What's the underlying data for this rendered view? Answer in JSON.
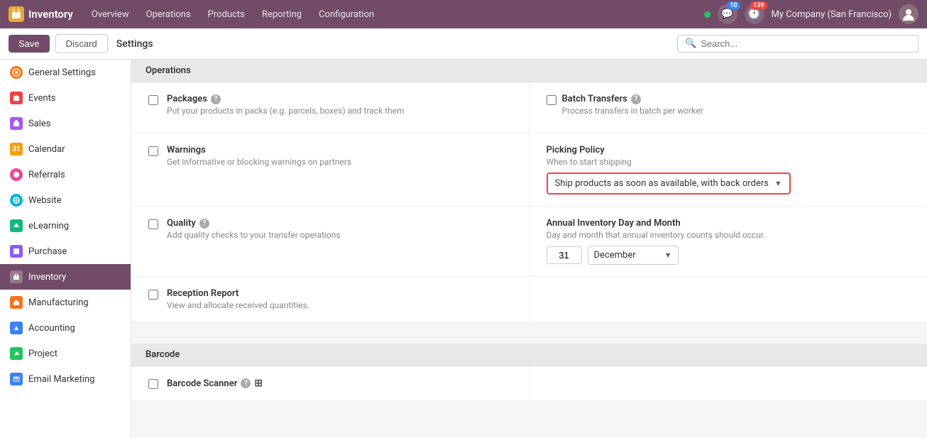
{
  "topnav": {
    "brand": "Inventory",
    "brand_icon": "📦",
    "nav_items": [
      "Overview",
      "Operations",
      "Products",
      "Reporting",
      "Configuration"
    ],
    "notifications": [
      {
        "count": "10",
        "type": "message",
        "color": "blue"
      },
      {
        "count": "139",
        "type": "activity",
        "color": "red"
      }
    ],
    "company": "My Company (San Francisco)",
    "avatar_char": "👤"
  },
  "toolbar": {
    "save_label": "Save",
    "discard_label": "Discard",
    "title": "Settings",
    "search_placeholder": "Search..."
  },
  "sidebar": {
    "items": [
      {
        "id": "general",
        "label": "General Settings",
        "icon_color": "#f97316"
      },
      {
        "id": "events",
        "label": "Events",
        "icon_color": "#ef4444"
      },
      {
        "id": "sales",
        "label": "Sales",
        "icon_color": "#a855f7"
      },
      {
        "id": "calendar",
        "label": "Calendar",
        "icon_color": "#f59e0b"
      },
      {
        "id": "referrals",
        "label": "Referrals",
        "icon_color": "#ec4899"
      },
      {
        "id": "website",
        "label": "Website",
        "icon_color": "#06b6d4"
      },
      {
        "id": "elearning",
        "label": "eLearning",
        "icon_color": "#10b981"
      },
      {
        "id": "purchase",
        "label": "Purchase",
        "icon_color": "#8b5cf6"
      },
      {
        "id": "inventory",
        "label": "Inventory",
        "icon_color": "#714b67",
        "active": true
      },
      {
        "id": "manufacturing",
        "label": "Manufacturing",
        "icon_color": "#f97316"
      },
      {
        "id": "accounting",
        "label": "Accounting",
        "icon_color": "#3b82f6"
      },
      {
        "id": "project",
        "label": "Project",
        "icon_color": "#22c55e"
      },
      {
        "id": "emailmkt",
        "label": "Email Marketing",
        "icon_color": "#3b82f6"
      }
    ]
  },
  "content": {
    "section_operations": "Operations",
    "section_barcode": "Barcode",
    "settings": [
      {
        "id": "packages",
        "label": "Packages",
        "desc": "Put your products in packs (e.g. parcels, boxes) and track them",
        "has_help": true,
        "checked": false,
        "right_label": "Batch Transfers",
        "right_desc": "Process transfers in batch per worker",
        "right_has_help": true,
        "right_checked": false
      },
      {
        "id": "warnings",
        "label": "Warnings",
        "desc": "Get informative or blocking warnings on partners",
        "has_help": false,
        "checked": false,
        "right_label": "Picking Policy",
        "right_desc": "When to start shipping",
        "right_has_help": false,
        "right_dropdown": true,
        "right_dropdown_value": "Ship products as soon as available, with back orders",
        "right_dropdown_highlighted": true
      },
      {
        "id": "quality",
        "label": "Quality",
        "desc": "Add quality checks to your transfer operations",
        "has_help": true,
        "checked": false,
        "right_label": "Annual Inventory Day and Month",
        "right_desc": "Day and month that annual inventory counts should occur.",
        "right_has_help": false,
        "right_annual": true,
        "annual_day": "31",
        "annual_month": "December"
      },
      {
        "id": "reception-report",
        "label": "Reception Report",
        "desc": "View and allocate received quantities.",
        "has_help": false,
        "checked": false,
        "right_empty": true
      }
    ],
    "barcode_settings": [
      {
        "id": "barcode-scanner",
        "label": "Barcode Scanner",
        "has_help": true,
        "has_grid_icon": true,
        "checked": false
      }
    ]
  }
}
